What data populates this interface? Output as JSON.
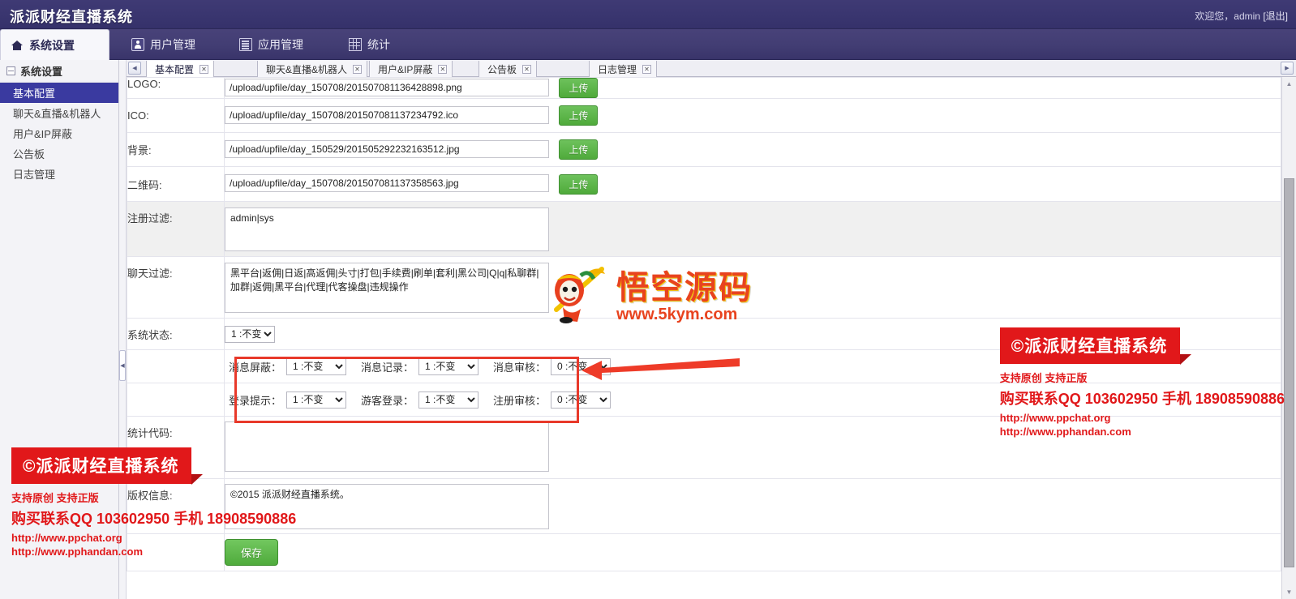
{
  "titlebar": {
    "app_title": "派派财经直播系统",
    "welcome": "欢迎您，admin",
    "logout": "[退出]"
  },
  "mainnav": {
    "items": [
      {
        "label": "系统设置",
        "icon": "home-icon",
        "active": true
      },
      {
        "label": "用户管理",
        "icon": "user-icon",
        "active": false
      },
      {
        "label": "应用管理",
        "icon": "app-list-icon",
        "active": false
      },
      {
        "label": "统计",
        "icon": "stats-grid-icon",
        "active": false
      }
    ]
  },
  "sidebar": {
    "header": "系统设置",
    "items": [
      {
        "label": "基本配置",
        "active": true
      },
      {
        "label": "聊天&直播&机器人",
        "active": false
      },
      {
        "label": "用户&IP屏蔽",
        "active": false
      },
      {
        "label": "公告板",
        "active": false
      },
      {
        "label": "日志管理",
        "active": false
      }
    ]
  },
  "tabstrip": {
    "scroll_left": "◀",
    "scroll_right": "▶",
    "close_glyph": "✕",
    "tabs": [
      {
        "label": "基本配置",
        "active": true
      },
      {
        "label": "聊天&直播&机器人",
        "active": false
      },
      {
        "label": "用户&IP屏蔽",
        "active": false
      },
      {
        "label": "公告板",
        "active": false
      },
      {
        "label": "日志管理",
        "active": false
      }
    ]
  },
  "form": {
    "upload_label": "上传",
    "save_label": "保存",
    "rows": [
      {
        "label": "LOGO:",
        "value": "/upload/upfile/day_150708/201507081136428898.png"
      },
      {
        "label": "ICO:",
        "value": "/upload/upfile/day_150708/201507081137234792.ico"
      },
      {
        "label": "背景:",
        "value": "/upload/upfile/day_150529/201505292232163512.jpg"
      },
      {
        "label": "二维码:",
        "value": "/upload/upfile/day_150708/201507081137358563.jpg"
      }
    ],
    "reg_filter_label": "注册过滤:",
    "reg_filter_value": "admin|sys",
    "chat_filter_label": "聊天过滤:",
    "chat_filter_value": "黑平台|返佣|日返|高返佣|头寸|打包|手续费|刷单|套利|黑公司|Q|q|私聊群|加群|返佣|黑平台|代理|代客操盘|违规操作",
    "sys_status_label": "系统状态:",
    "sys_status_value": "1 :不变",
    "options": [
      [
        {
          "label": "消息屏蔽：",
          "value": "1 :不变"
        },
        {
          "label": "消息记录：",
          "value": "1 :不变"
        },
        {
          "label": "消息审核：",
          "value": "0 :不变"
        }
      ],
      [
        {
          "label": "登录提示：",
          "value": "1 :不变"
        },
        {
          "label": "游客登录：",
          "value": "1 :不变"
        },
        {
          "label": "注册审核：",
          "value": "0 :不变"
        }
      ]
    ],
    "stat_code_label": "统计代码:",
    "stat_code_value": "",
    "copyright_label": "版权信息:",
    "copyright_value": "©2015 派派财经直播系统。"
  },
  "watermarks": {
    "badge": "©派派财经直播系统",
    "line1": "支持原创 支持正版",
    "line2": "购买联系QQ 103602950 手机 18908590886",
    "line3": "http://www.ppchat.org",
    "line4": "http://www.pphandan.com",
    "center_text": "悟空源码",
    "center_url": "www.5kym.com"
  },
  "colors": {
    "header_purple": "#3a3670",
    "nav_purple": "#423d73",
    "sidebar_active": "#3a3aa0",
    "green_button": "#4faa3b",
    "watermark_red": "#e1181a",
    "highlight_red": "#e8392a"
  }
}
